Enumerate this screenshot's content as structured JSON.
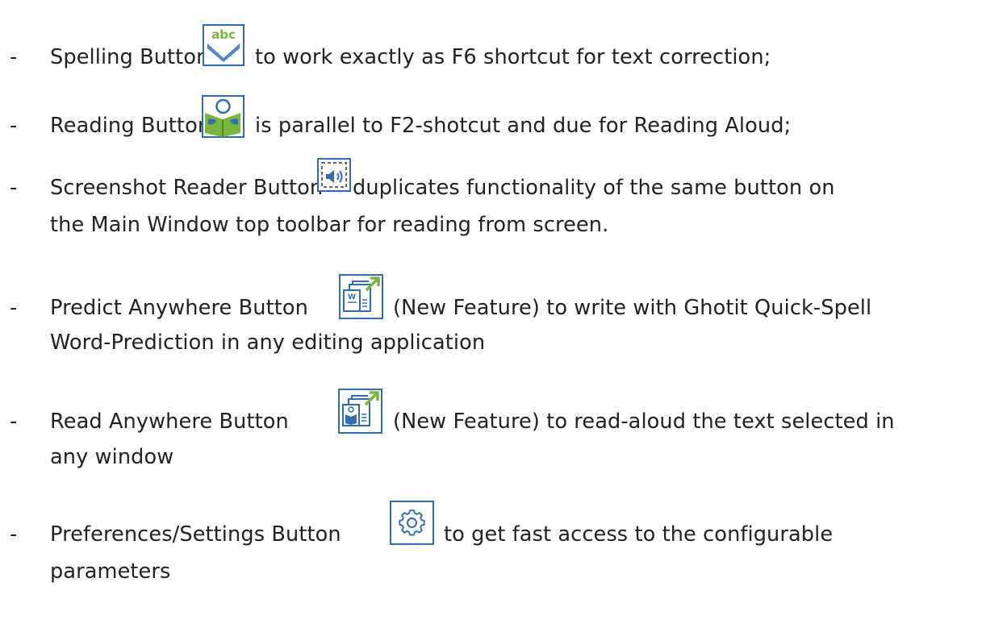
{
  "items": [
    {
      "dash": "-",
      "before": "Spelling Button",
      "after": "to work exactly as F6 shortcut for text correction;",
      "icon": "spelling-check-icon"
    },
    {
      "dash": "-",
      "before": "Reading Button",
      "after": "is parallel to F2-shotcut and due for Reading Aloud;",
      "icon": "reading-book-icon"
    },
    {
      "dash": "-",
      "before": "Screenshot Reader Button",
      "after": "duplicates functionality of the same button on",
      "cont": "the Main Window top toolbar for reading from screen.",
      "icon": "screenshot-reader-icon"
    },
    {
      "dash": "-",
      "before": "Predict Anywhere Button",
      "after": "(New Feature) to write with Ghotit Quick-Spell",
      "cont": "Word-Prediction in any editing application",
      "icon": "predict-anywhere-icon"
    },
    {
      "dash": "-",
      "before": "Read Anywhere Button",
      "after": "(New Feature) to read-aloud the text selected in",
      "cont": "any window",
      "icon": "read-anywhere-icon"
    },
    {
      "dash": "-",
      "before": "Preferences/Settings Button",
      "after": "to get fast access to the configurable",
      "cont": "parameters",
      "icon": "gear-icon"
    }
  ],
  "icon_text": {
    "abc": "abc",
    "w": "W"
  },
  "colors": {
    "icon_blue": "#2f6db0",
    "icon_green": "#7ab53c",
    "text": "#222222"
  }
}
